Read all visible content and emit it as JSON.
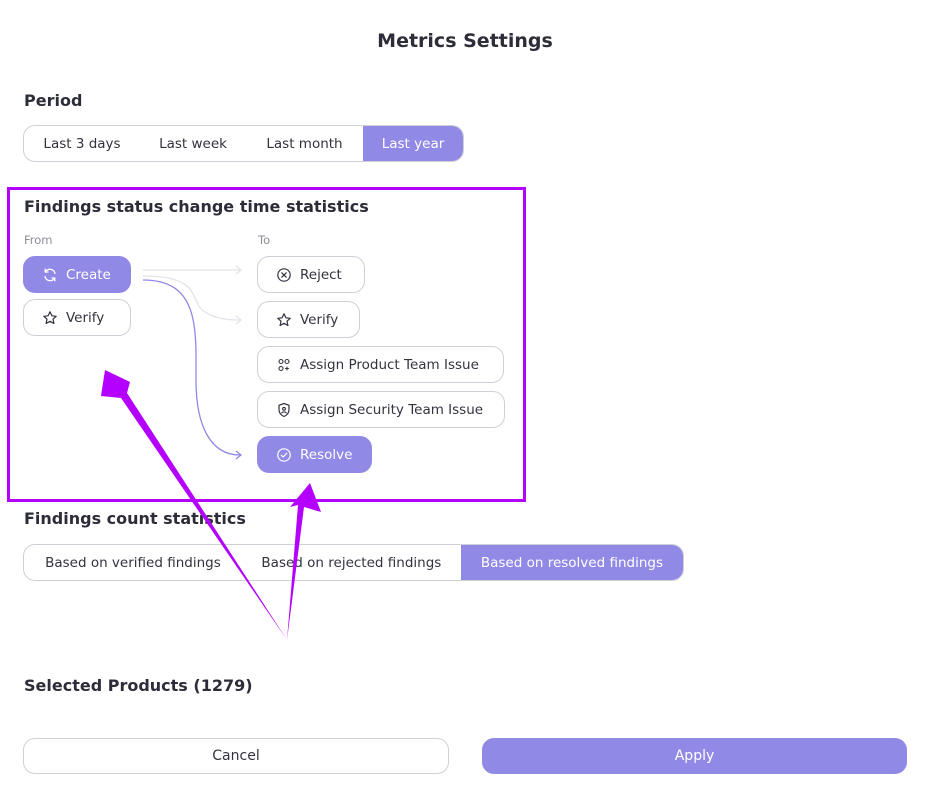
{
  "title": "Metrics Settings",
  "period": {
    "label": "Period",
    "options": [
      "Last 3 days",
      "Last week",
      "Last month",
      "Last year"
    ],
    "selected": "Last year"
  },
  "status_stats": {
    "label": "Findings status change time statistics",
    "from_label": "From",
    "to_label": "To",
    "from": [
      {
        "label": "Create",
        "icon": "refresh-icon",
        "active": true
      },
      {
        "label": "Verify",
        "icon": "star-icon",
        "active": false
      }
    ],
    "to": [
      {
        "label": "Reject",
        "icon": "x-circle-icon",
        "active": false
      },
      {
        "label": "Verify",
        "icon": "star-icon",
        "active": false
      },
      {
        "label": "Assign Product Team Issue",
        "icon": "team-icon",
        "active": false
      },
      {
        "label": "Assign Security Team Issue",
        "icon": "shield-user-icon",
        "active": false
      },
      {
        "label": "Resolve",
        "icon": "check-circle-icon",
        "active": true
      }
    ]
  },
  "count_stats": {
    "label": "Findings count statistics",
    "options": [
      "Based on verified findings",
      "Based on rejected findings",
      "Based on resolved findings"
    ],
    "selected": "Based on resolved findings"
  },
  "selected_products": "Selected Products (1279)",
  "actions": {
    "cancel": "Cancel",
    "apply": "Apply"
  },
  "colors": {
    "accent": "#9189e6",
    "annotation": "#b400ff",
    "border": "#cfcfd8"
  }
}
